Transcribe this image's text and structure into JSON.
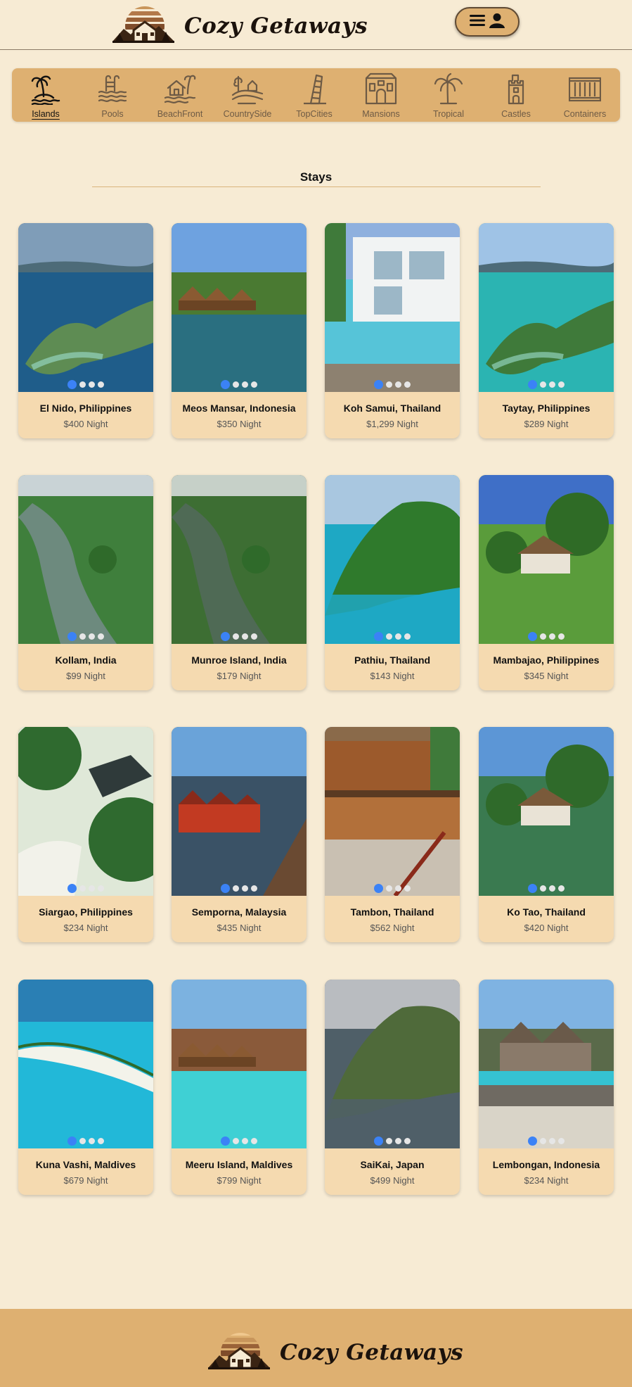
{
  "brand": {
    "name": "Cozy Getaways",
    "logo_icon": "cabin-sunset-logo"
  },
  "header": {
    "menu_icon": "hamburger-icon",
    "profile_icon": "user-icon"
  },
  "categories": [
    {
      "label": "Islands",
      "icon": "palm-island-icon",
      "active": true
    },
    {
      "label": "Pools",
      "icon": "pool-waves-icon"
    },
    {
      "label": "BeachFront",
      "icon": "beach-house-icon"
    },
    {
      "label": "CountrySide",
      "icon": "countryside-icon"
    },
    {
      "label": "TopCities",
      "icon": "leaning-tower-icon"
    },
    {
      "label": "Mansions",
      "icon": "mansion-icon"
    },
    {
      "label": "Tropical",
      "icon": "palm-tree-icon"
    },
    {
      "label": "Castles",
      "icon": "castle-icon"
    },
    {
      "label": "Containers",
      "icon": "container-icon"
    }
  ],
  "stays": {
    "title": "Stays",
    "items": [
      {
        "name": "El Nido, Philippines",
        "price": "$400 Night"
      },
      {
        "name": "Meos Mansar, Indonesia",
        "price": "$350 Night"
      },
      {
        "name": "Koh Samui, Thailand",
        "price": "$1,299 Night"
      },
      {
        "name": "Taytay, Philippines",
        "price": "$289 Night"
      },
      {
        "name": "Kollam, India",
        "price": "$99 Night"
      },
      {
        "name": "Munroe Island, India",
        "price": "$179 Night"
      },
      {
        "name": "Pathiu, Thailand",
        "price": "$143 Night"
      },
      {
        "name": "Mambajao, Philippines",
        "price": "$345 Night"
      },
      {
        "name": "Siargao, Philippines",
        "price": "$234 Night"
      },
      {
        "name": "Semporna, Malaysia",
        "price": "$435 Night"
      },
      {
        "name": "Tambon, Thailand",
        "price": "$562 Night"
      },
      {
        "name": "Ko Tao, Thailand",
        "price": "$420 Night"
      },
      {
        "name": "Kuna Vashi, Maldives",
        "price": "$679 Night"
      },
      {
        "name": "Meeru Island, Maldives",
        "price": "$799 Night"
      },
      {
        "name": "SaiKai, Japan",
        "price": "$499 Night"
      },
      {
        "name": "Lembongan, Indonesia",
        "price": "$234 Night"
      }
    ]
  },
  "carousel": {
    "dot_count": 4,
    "active_index": 0,
    "active_color": "#3b82f6"
  },
  "colors": {
    "page_bg": "#f7ebd4",
    "accent": "#deb071",
    "card_bg": "#f5dab0"
  }
}
